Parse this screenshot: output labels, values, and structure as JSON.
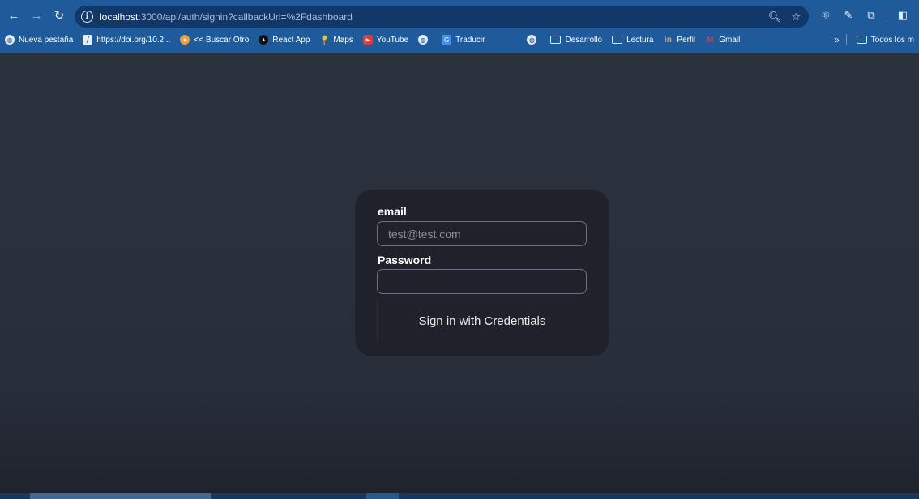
{
  "browser": {
    "url_host": "localhost",
    "url_rest": ":3000/api/auth/signin?callbackUrl=%2Fdashboard",
    "bookmarks": [
      {
        "label": "Nueva pestaña",
        "icon": "globe-icon"
      },
      {
        "label": "https://doi.org/10.2...",
        "icon": "doi-icon"
      },
      {
        "label": "<< Buscar Otro",
        "icon": "buscar-icon"
      },
      {
        "label": "React App",
        "icon": "react-icon"
      },
      {
        "label": "Maps",
        "icon": "maps-icon"
      },
      {
        "label": "YouTube",
        "icon": "youtube-icon"
      },
      {
        "label": "",
        "icon": "globe-icon"
      },
      {
        "label": "Traducir",
        "icon": "translate-icon"
      },
      {
        "label": "",
        "icon": "globe-icon"
      },
      {
        "label": "Desarrollo",
        "icon": "folder-icon"
      },
      {
        "label": "Lectura",
        "icon": "folder-icon"
      },
      {
        "label": "Perfil",
        "icon": "perfil-icon"
      },
      {
        "label": "Gmail",
        "icon": "gmail-icon"
      }
    ],
    "more_bookmarks_label": "Todos los m"
  },
  "signin": {
    "email_label": "email",
    "email_placeholder": "test@test.com",
    "password_label": "Password",
    "submit_label": "Sign in with Credentials"
  },
  "colors": {
    "chrome_bg": "#1f5a9a",
    "omnibox_bg": "#12386a",
    "page_bg": "#2a303c",
    "card_bg": "#1f222b"
  }
}
